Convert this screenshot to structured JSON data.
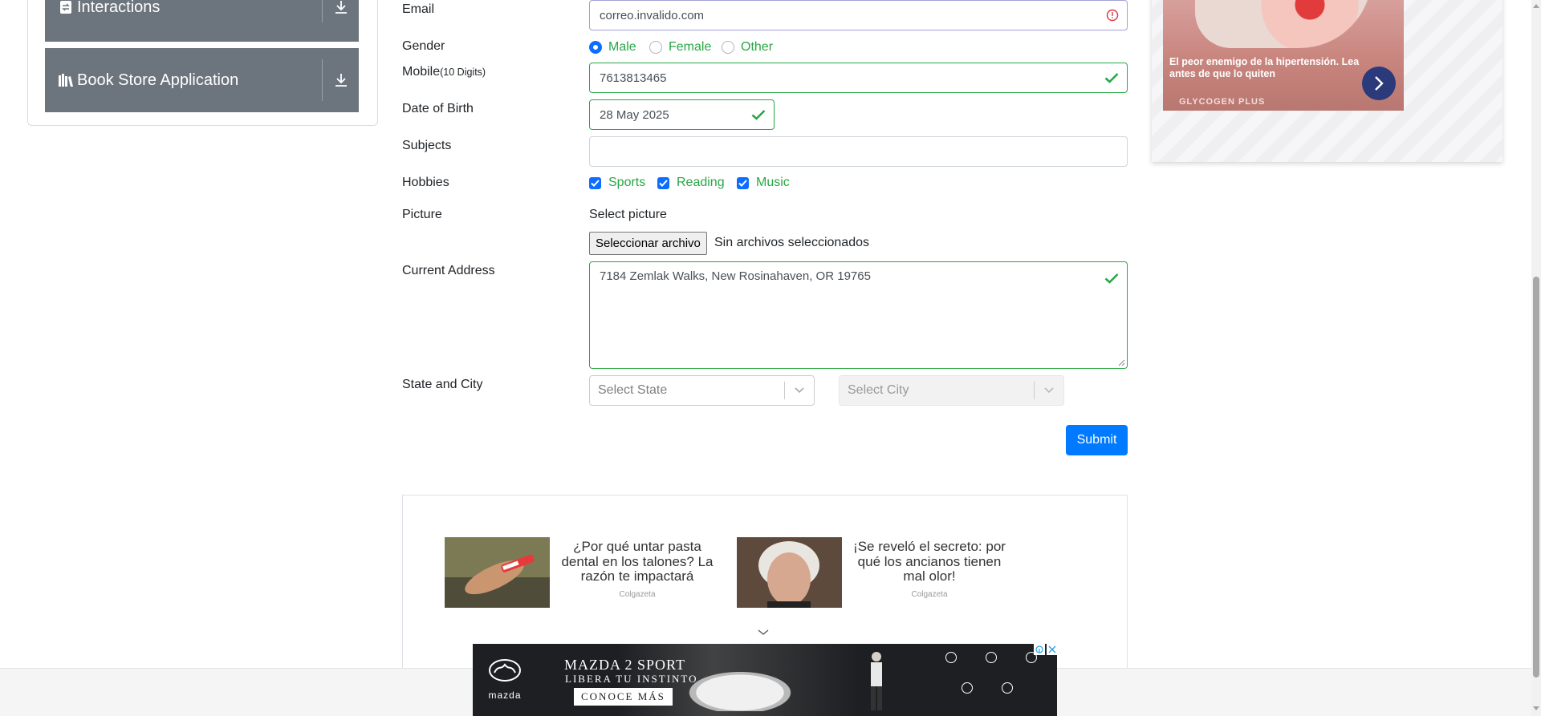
{
  "sidebar": {
    "groups": [
      {
        "label": "Interactions",
        "icon": "interactions-icon"
      },
      {
        "label": "Book Store Application",
        "icon": "book-icon"
      }
    ]
  },
  "form": {
    "email": {
      "label": "Email",
      "value": "correo.invalido.com",
      "state": "invalid"
    },
    "gender": {
      "label": "Gender",
      "options": [
        "Male",
        "Female",
        "Other"
      ],
      "selected": "Male"
    },
    "mobile": {
      "label": "Mobile",
      "sublabel": "(10 Digits)",
      "value": "7613813465",
      "state": "valid"
    },
    "dob": {
      "label": "Date of Birth",
      "value": "28 May 2025",
      "state": "valid"
    },
    "subjects": {
      "label": "Subjects",
      "value": ""
    },
    "hobbies": {
      "label": "Hobbies",
      "options": [
        "Sports",
        "Reading",
        "Music"
      ],
      "checked": [
        "Sports",
        "Reading",
        "Music"
      ]
    },
    "picture": {
      "label": "Picture",
      "select_text": "Select picture",
      "button": "Seleccionar archivo",
      "status": "Sin archivos seleccionados"
    },
    "address": {
      "label": "Current Address",
      "value": "7184 Zemlak Walks, New Rosinahaven, OR 19765",
      "state": "valid"
    },
    "state_city": {
      "label": "State and City",
      "state_placeholder": "Select State",
      "city_placeholder": "Select City"
    },
    "submit": "Submit"
  },
  "right_ad": {
    "text": "El peor enemigo de la hipertensión. Lea antes de que lo quiten",
    "brand": "GLYCOGEN PLUS"
  },
  "native_ads": [
    {
      "title": "¿Por qué untar pasta dental en los talones? La razón te impactará",
      "brand": "Colgazeta"
    },
    {
      "title": "¡Se reveló el secreto: por qué los ancianos tienen mal olor!",
      "brand": "Colgazeta"
    }
  ],
  "banner": {
    "brand": "mazda",
    "headline": "MAZDA 2 SPORT",
    "subline": "LIBERA TU INSTINTO",
    "cta": "CONOCE MÁS"
  },
  "colors": {
    "valid": "#28a745",
    "invalid": "#dc3545",
    "primary": "#007bff",
    "menu": "#6c757d"
  }
}
